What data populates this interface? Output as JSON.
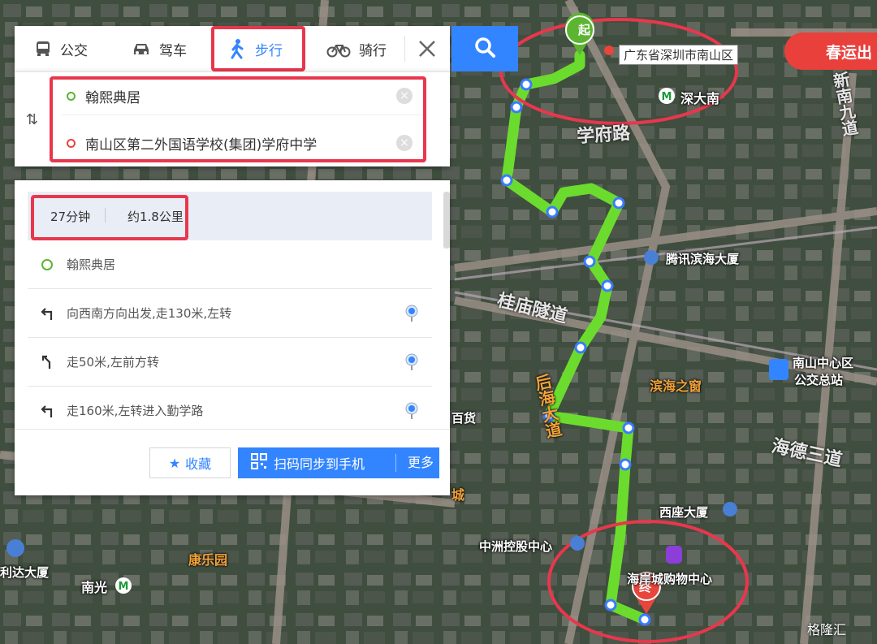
{
  "tabs": [
    {
      "label": "公交",
      "icon": "bus-icon"
    },
    {
      "label": "驾车",
      "icon": "car-icon"
    },
    {
      "label": "步行",
      "icon": "walk-icon",
      "active": true
    },
    {
      "label": "骑行",
      "icon": "bike-icon"
    }
  ],
  "route": {
    "start": "翰熙典居",
    "end": "南山区第二外国语学校(集团)学府中学"
  },
  "summary": {
    "time": "27分钟",
    "distance": "约1.8公里"
  },
  "steps": [
    {
      "text": "翰熙典居",
      "icon": "start-dot-icon"
    },
    {
      "text": "向西南方向出发,走130米,左转",
      "icon": "turn-left-icon"
    },
    {
      "text": "走50米,左前方转",
      "icon": "bear-left-icon"
    },
    {
      "text": "走160米,左转进入勤学路",
      "icon": "turn-left-icon"
    }
  ],
  "footer": {
    "favorite": "收藏",
    "sync": "扫码同步到手机",
    "more": "更多"
  },
  "map": {
    "address_popup": "广东省深圳市南山区",
    "banner": "春运出",
    "start_marker": "起",
    "end_marker": "终",
    "labels": {
      "shenda": "深大南",
      "xuefu_road": "学府路",
      "tencent": "腾讯滨海大厦",
      "guimiao": "桂庙隧道",
      "houhai": "后海大道",
      "binhai_window": "滨海之窗",
      "nanshan_bus": "南山中心区",
      "nanshan_bus2": "公交总站",
      "haide": "海德三道",
      "xizuo": "西座大厦",
      "zhongzhou": "中洲控股中心",
      "mall": "海岸城购物中心",
      "kangle": "康乐园",
      "nanguang": "南光",
      "lida": "利达大厦",
      "baihuo": "百货",
      "xinnan": "新南九道",
      "cheng": "城"
    },
    "watermark": "格隆汇"
  },
  "colors": {
    "accent": "#3385ff",
    "highlight": "#e8374d",
    "route": "#6bdc2e",
    "start": "#5cb531",
    "end": "#e8453c"
  }
}
